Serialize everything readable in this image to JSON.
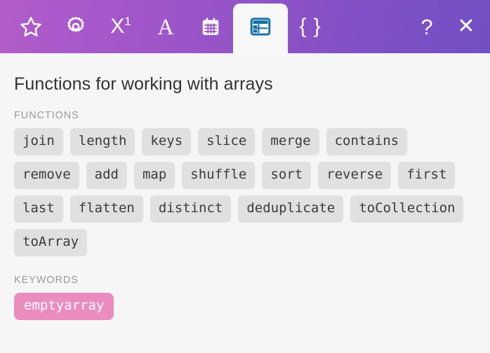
{
  "window": {
    "background_color": "#f6f6f6",
    "header_gradient_start": "#b25ccb",
    "header_gradient_end": "#7150c4"
  },
  "toolbar": {
    "tabs": [
      {
        "name": "favorites",
        "icon": "star-icon",
        "label": "",
        "active": false
      },
      {
        "name": "settings",
        "icon": "gear-icon",
        "label": "",
        "active": false
      },
      {
        "name": "math",
        "icon": "exponent-icon",
        "label": "X",
        "superscript": "1",
        "active": false
      },
      {
        "name": "text",
        "icon": "letter-a-icon",
        "label": "A",
        "active": false
      },
      {
        "name": "date",
        "icon": "calendar-icon",
        "label": "",
        "active": false
      },
      {
        "name": "arrays",
        "icon": "table-grid-icon",
        "label": "",
        "active": true
      },
      {
        "name": "objects",
        "icon": "curly-braces-icon",
        "label": "{ }",
        "active": false
      }
    ],
    "help_label": "?",
    "close_label": "✕",
    "active_icon_color": "#1370a8"
  },
  "main": {
    "title": "Functions for working with arrays",
    "functions_label": "FUNCTIONS",
    "functions": [
      "join",
      "length",
      "keys",
      "slice",
      "merge",
      "contains",
      "remove",
      "add",
      "map",
      "shuffle",
      "sort",
      "reverse",
      "first",
      "last",
      "flatten",
      "distinct",
      "deduplicate",
      "toCollection",
      "toArray"
    ],
    "keywords_label": "KEYWORDS",
    "keywords": [
      "emptyarray"
    ],
    "chip_background": "#e0e0e0",
    "keyword_background": "#ea8cbe"
  }
}
